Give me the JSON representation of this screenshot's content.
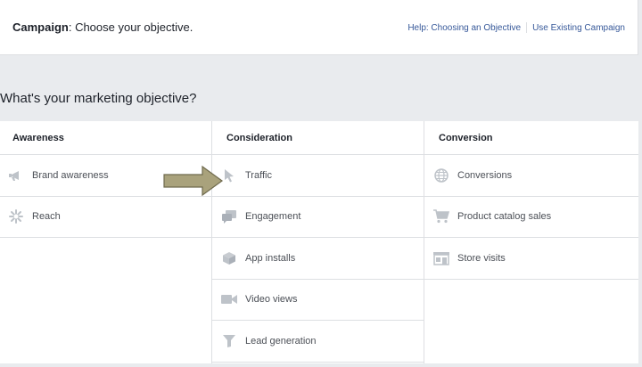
{
  "header": {
    "title_bold": "Campaign",
    "title_rest": ": Choose your objective.",
    "help_link": "Help: Choosing an Objective",
    "existing_link": "Use Existing Campaign"
  },
  "question": "What's your marketing objective?",
  "columns": [
    {
      "heading": "Awareness",
      "items": [
        {
          "label": "Brand awareness",
          "icon": "megaphone-icon"
        },
        {
          "label": "Reach",
          "icon": "starburst-icon"
        }
      ]
    },
    {
      "heading": "Consideration",
      "items": [
        {
          "label": "Traffic",
          "icon": "cursor-icon"
        },
        {
          "label": "Engagement",
          "icon": "chat-bubbles-icon"
        },
        {
          "label": "App installs",
          "icon": "box-icon"
        },
        {
          "label": "Video views",
          "icon": "video-camera-icon"
        },
        {
          "label": "Lead generation",
          "icon": "funnel-icon"
        }
      ]
    },
    {
      "heading": "Conversion",
      "items": [
        {
          "label": "Conversions",
          "icon": "globe-icon"
        },
        {
          "label": "Product catalog sales",
          "icon": "shopping-cart-icon"
        },
        {
          "label": "Store visits",
          "icon": "storefront-icon"
        }
      ]
    }
  ],
  "colors": {
    "icon": "#bec3c9",
    "link": "#365899",
    "arrow": "#a9a27c",
    "divider": "#dddfe2"
  }
}
